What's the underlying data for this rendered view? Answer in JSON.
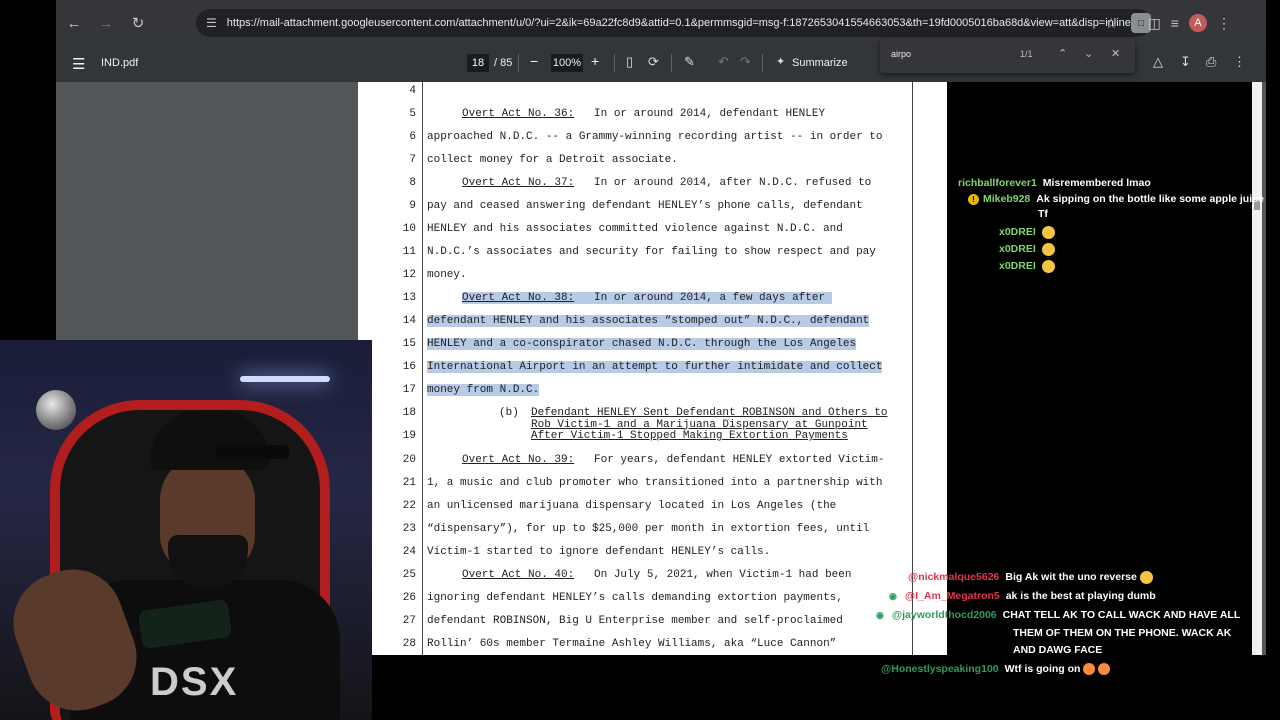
{
  "browser": {
    "url": "https://mail-attachment.googleusercontent.com/attachment/u/0/?ui=2&ik=69a22fc8d9&attid=0.1&permmsgid=msg-f:1872653041554663053&th=19fd0005016ba68d&view=att&disp=inline&realattid...",
    "profile_initial": "A"
  },
  "pdf": {
    "filename": "IND.pdf",
    "page_current": "18",
    "page_total": "/ 85",
    "zoom": "100%",
    "summarize_label": "Summarize"
  },
  "find": {
    "query": "airpo",
    "count": "1/1"
  },
  "document": {
    "lines": [
      {
        "n": "4",
        "text": ""
      },
      {
        "n": "5",
        "text": "approached N.D.C. -- a Grammy-winning recording artist -- in order to"
      },
      {
        "n": "7",
        "text": "collect money for a Detroit associate."
      },
      {
        "n": "9",
        "text": "pay and ceased answering defendant HENLEY’s phone calls, defendant"
      },
      {
        "n": "10",
        "text": "HENLEY and his associates committed violence against N.D.C. and"
      },
      {
        "n": "11",
        "text": "N.D.C.’s associates and security for failing to show respect and pay"
      },
      {
        "n": "12",
        "text": "money."
      },
      {
        "n": "14",
        "text": "defendant HENLEY and his associates “stomped out” N.D.C., defendant"
      },
      {
        "n": "15",
        "text": "HENLEY and a co-conspirator chased N.D.C. through the Los Angeles"
      },
      {
        "n": "16",
        "text": "International Airport in an attempt to further intimidate and collect"
      },
      {
        "n": "17",
        "text": "money from N.D.C."
      },
      {
        "n": "21",
        "text": "1, a music and club promoter who transitioned into a partnership with"
      },
      {
        "n": "22",
        "text": "an unlicensed marijuana dispensary located in Los Angeles (the"
      },
      {
        "n": "23",
        "text": "“dispensary”), for up to $25,000 per month in extortion fees, until"
      },
      {
        "n": "24",
        "text": "Victim-1 started to ignore defendant HENLEY’s calls."
      },
      {
        "n": "26",
        "text": "ignoring defendant HENLEY’s calls demanding extortion payments,"
      },
      {
        "n": "27",
        "text": "defendant ROBINSON, Big U Enterprise member and self-proclaimed"
      },
      {
        "n": "28",
        "text": "Rollin’ 60s member Termaine Ashley Williams, aka “Luce Cannon”"
      }
    ],
    "act36_label": "Overt Act No. 36:",
    "act36_text": "In or around 2014, defendant HENLEY",
    "act37_label": "Overt Act No. 37:",
    "act37_text": "In or around 2014, after N.D.C. refused to",
    "act38_label": "Overt Act No. 38:",
    "act38_text": "In or around 2014, a few days after",
    "subsection_mark": "(b)",
    "subsection_lines": [
      "Defendant HENLEY Sent Defendant ROBINSON and Others to",
      "Rob Victim-1 and a Marijuana Dispensary at Gunpoint",
      "After Victim-1 Stopped Making Extortion Payments"
    ],
    "act39_label": "Overt Act No. 39:",
    "act39_text": "For years, defendant HENLEY extorted Victim-",
    "act40_label": "Overt Act No. 40:",
    "act40_text": "On July 5, 2021, when Victim-1 had been",
    "n6": "6",
    "n8": "8",
    "n13": "13",
    "n18": "18",
    "n19": "19",
    "n20": "20",
    "n25": "25"
  },
  "chat_top": [
    {
      "user": "richballforever1",
      "user_color": "#7fd66b",
      "msg": "Misremembered lmao"
    },
    {
      "user": "Mikeb928",
      "user_color": "#7fd66b",
      "msg": "Ak sipping on the bottle like some apple juice",
      "msg2": "Tf"
    },
    {
      "user": "x0DREI",
      "user_color": "#7fd66b"
    },
    {
      "user": "x0DREI",
      "user_color": "#7fd66b"
    },
    {
      "user": "x0DREI",
      "user_color": "#7fd66b"
    }
  ],
  "chat_bottom": [
    {
      "user": "@nickmalque5626",
      "user_color": "#e0344d",
      "msg": "Big Ak wit the uno reverse"
    },
    {
      "user": "@I_Am_Megatron5",
      "user_color": "#e0344d",
      "msg": "ak is the best at playing dumb"
    },
    {
      "user": "@jayworldthocd2006",
      "user_color": "#2e9a5e",
      "msg": "CHAT TELL AK TO CALL WACK AND HAVE ALL",
      "msg2": "THEM OF THEM ON THE PHONE. WACK AK",
      "msg3": "AND DAWG FACE"
    },
    {
      "user": "@Honestlyspeaking100",
      "user_color": "#2e9a5e",
      "msg": "Wtf is going on"
    }
  ],
  "webcam": {
    "jersey_text": "DSX"
  }
}
